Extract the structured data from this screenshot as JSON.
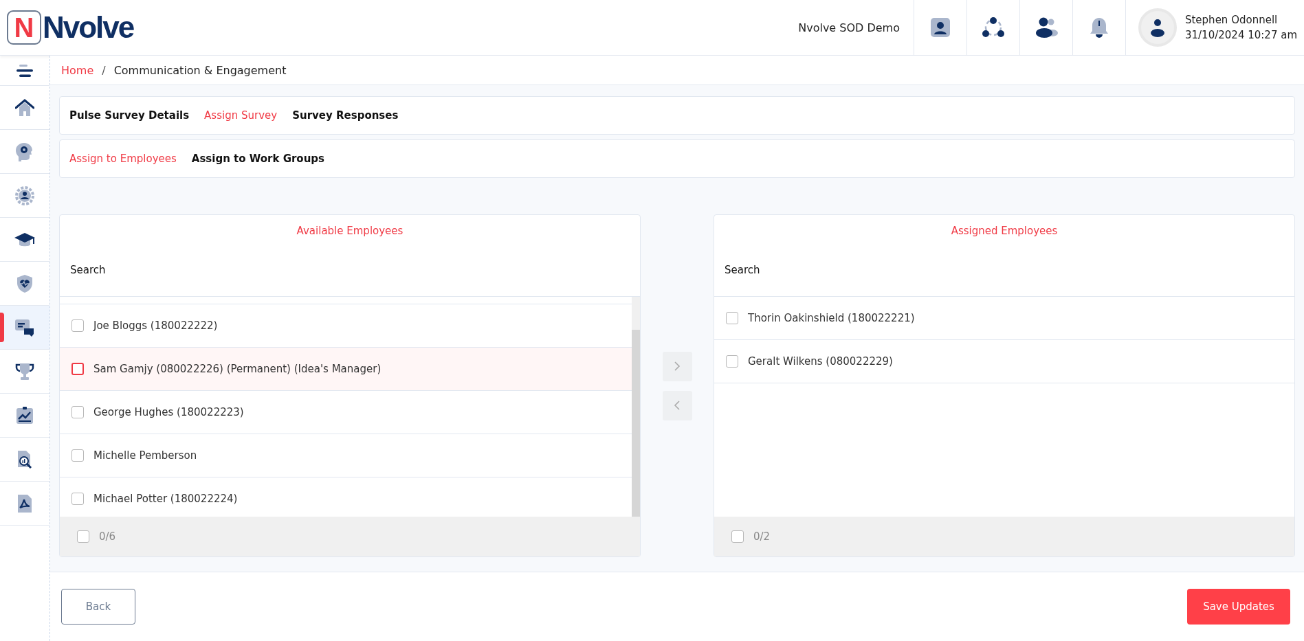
{
  "header": {
    "logo_letter": "N",
    "logo_text": "Nvolve",
    "org_name": "Nvolve SOD Demo",
    "icons": [
      {
        "kind": "contact"
      },
      {
        "kind": "network"
      },
      {
        "kind": "team"
      },
      {
        "kind": "bell"
      }
    ],
    "user": {
      "name": "Stephen Odonnell",
      "datetime": "31/10/2024 10:27 am"
    }
  },
  "sidebar": {
    "items": [
      {
        "kind": "menu",
        "selected": false
      },
      {
        "kind": "home",
        "selected": false
      },
      {
        "kind": "head",
        "selected": false
      },
      {
        "kind": "gear",
        "selected": false
      },
      {
        "kind": "cap",
        "selected": false
      },
      {
        "kind": "shield",
        "selected": false
      },
      {
        "kind": "chat",
        "selected": true
      },
      {
        "kind": "trophy",
        "selected": false
      },
      {
        "kind": "chart",
        "selected": false
      },
      {
        "kind": "docsearch",
        "selected": false
      },
      {
        "kind": "pdf",
        "selected": false
      }
    ]
  },
  "breadcrumb": [
    {
      "label": "Home",
      "link": true
    },
    {
      "label": "Communication & Engagement",
      "link": false
    }
  ],
  "breadcrumb_separator": "/",
  "tabs": [
    {
      "label": "Pulse Survey Details",
      "selected": false
    },
    {
      "label": "Assign Survey",
      "selected": true
    },
    {
      "label": "Survey Responses",
      "selected": false
    }
  ],
  "subtabs": [
    {
      "label": "Assign to Employees",
      "selected": true
    },
    {
      "label": "Assign to Work Groups",
      "selected": false
    }
  ],
  "panels": [
    {
      "title": "Available Employees",
      "search_label": "Search",
      "scrollable": true,
      "items": [
        {
          "label": "Joe Bloggs (180022222)",
          "checked": false,
          "focused": false
        },
        {
          "label": "Sam Gamjy (080022226) (Permanent) (Idea's Manager)",
          "checked": false,
          "focused": true
        },
        {
          "label": "George Hughes (180022223)",
          "checked": false,
          "focused": false
        },
        {
          "label": "Michelle Pemberson",
          "checked": false,
          "focused": false
        },
        {
          "label": "Michael Potter (180022224)",
          "checked": false,
          "focused": false
        }
      ],
      "footer": {
        "count": "0/6",
        "checked": false
      }
    },
    {
      "title": "Assigned Employees",
      "search_label": "Search",
      "scrollable": false,
      "items": [
        {
          "label": "Thorin Oakinshield (180022221)",
          "checked": false,
          "focused": false
        },
        {
          "label": "Geralt Wilkens (080022229)",
          "checked": false,
          "focused": false
        }
      ],
      "footer": {
        "count": "0/2",
        "checked": false
      }
    }
  ],
  "transfer_buttons": [
    {
      "kind": "right",
      "disabled": true
    },
    {
      "kind": "left",
      "disabled": true
    }
  ],
  "buttons": [
    {
      "label": "Back",
      "kind": "secondary"
    },
    {
      "label": "Save Updates",
      "kind": "primary"
    }
  ]
}
